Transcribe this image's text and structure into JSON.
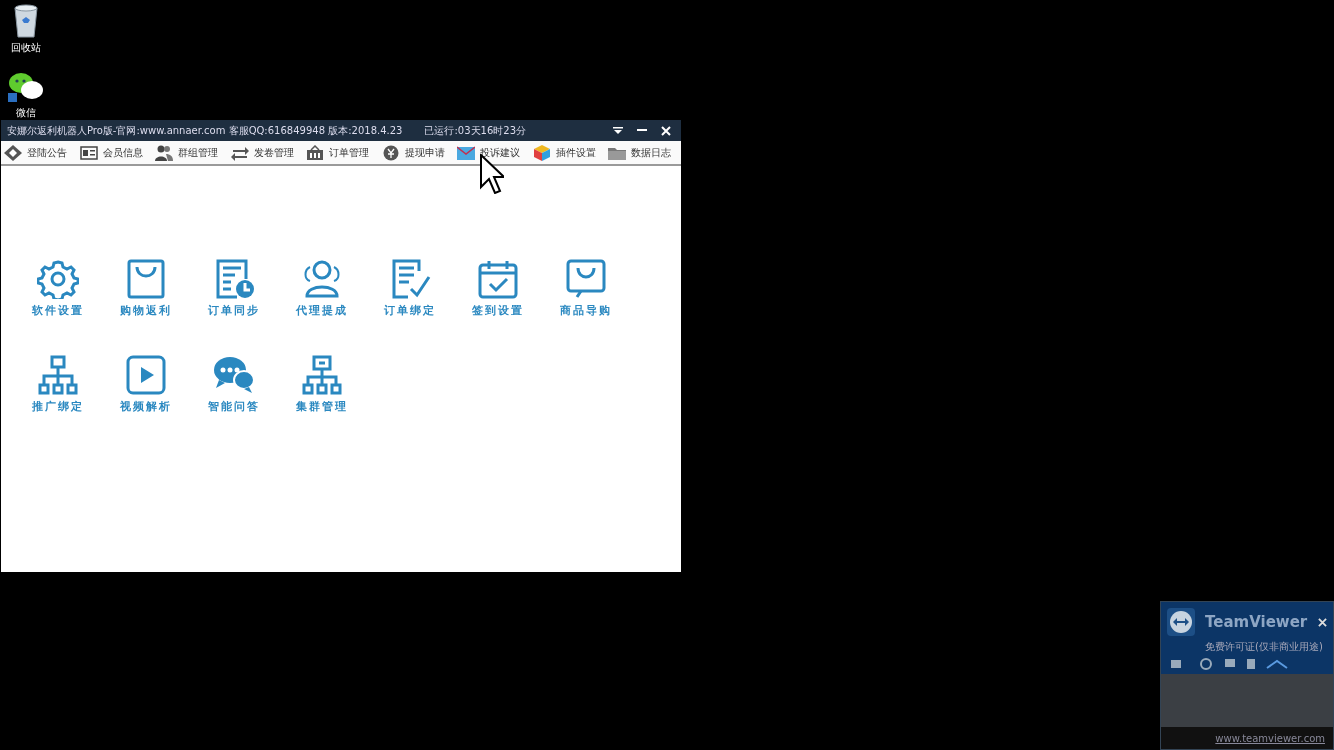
{
  "desktop_icons": [
    {
      "label": "回收站"
    },
    {
      "label": "微信"
    }
  ],
  "window": {
    "title": "安娜尔返利机器人Pro版-官网:www.annaer.com 客服QQ:616849948 版本:2018.4.23",
    "uptime": "已运行:03天16时23分"
  },
  "toolbar": [
    {
      "label": "登陆公告"
    },
    {
      "label": "会员信息"
    },
    {
      "label": "群组管理"
    },
    {
      "label": "发卷管理"
    },
    {
      "label": "订单管理"
    },
    {
      "label": "提现申请"
    },
    {
      "label": "投诉建议"
    },
    {
      "label": "插件设置"
    },
    {
      "label": "数据日志"
    }
  ],
  "tiles": [
    {
      "label": "软件设置"
    },
    {
      "label": "购物返利"
    },
    {
      "label": "订单同步"
    },
    {
      "label": "代理提成"
    },
    {
      "label": "订单绑定"
    },
    {
      "label": "签到设置"
    },
    {
      "label": "商品导购"
    },
    {
      "label": "推广绑定"
    },
    {
      "label": "视频解析"
    },
    {
      "label": "智能问答"
    },
    {
      "label": "集群管理"
    }
  ],
  "teamviewer": {
    "title": "TeamViewer",
    "subtitle": "免费许可证(仅非商业用途)",
    "link": "www.teamviewer.com"
  }
}
